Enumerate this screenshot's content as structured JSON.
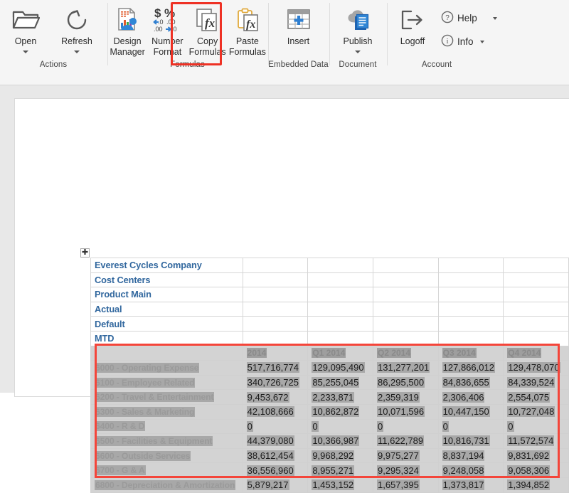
{
  "ribbon": {
    "groups": [
      {
        "name": "actions",
        "label": "Actions",
        "buttons": [
          {
            "name": "open-button",
            "label": "Open",
            "icon": "folder-open-icon",
            "dropdown": true
          },
          {
            "name": "refresh-button",
            "label": "Refresh",
            "icon": "refresh-icon",
            "dropdown": true
          }
        ]
      },
      {
        "name": "formulas",
        "label": "Formulas",
        "buttons": [
          {
            "name": "design-manager-button",
            "label": "Design\nManager",
            "icon": "design-manager-icon",
            "dropdown": false
          },
          {
            "name": "number-format-button",
            "label": "Number\nFormat",
            "icon": "number-format-icon",
            "dropdown": false
          },
          {
            "name": "copy-formulas-button",
            "label": "Copy\nFormulas",
            "icon": "copy-formulas-icon",
            "dropdown": false,
            "highlighted": true
          },
          {
            "name": "paste-formulas-button",
            "label": "Paste\nFormulas",
            "icon": "paste-formulas-icon",
            "dropdown": false
          }
        ]
      },
      {
        "name": "embedded-data",
        "label": "Embedded Data",
        "buttons": [
          {
            "name": "insert-button",
            "label": "Insert",
            "icon": "insert-table-icon",
            "dropdown": false
          }
        ]
      },
      {
        "name": "document",
        "label": "Document",
        "buttons": [
          {
            "name": "publish-button",
            "label": "Publish",
            "icon": "publish-cloud-icon",
            "dropdown": true
          }
        ]
      },
      {
        "name": "account",
        "label": "Account",
        "buttons": [
          {
            "name": "logoff-button",
            "label": "Logoff",
            "icon": "logoff-icon",
            "dropdown": false
          }
        ],
        "small_buttons": [
          {
            "name": "help-button",
            "label": "Help",
            "icon": "help-circle-icon",
            "dropdown": true
          },
          {
            "name": "info-button",
            "label": "Info",
            "icon": "info-circle-icon",
            "dropdown": true
          }
        ]
      }
    ],
    "number_format_icon_text": {
      "currency": "$",
      "percent": "%",
      "decrease_decimal": ".00",
      "increase_decimal": ".0"
    }
  },
  "document": {
    "move_handle_icon": "move-table-handle-icon",
    "report_header_rows": [
      "Everest Cycles Company",
      "Cost Centers",
      "Product Main",
      "Actual",
      "Default",
      "MTD"
    ]
  },
  "grid": {
    "selected": true,
    "selection_color": "#f4453a",
    "header_text_color": "#31679e",
    "column_headers": [
      "",
      "2014",
      "Q1 2014",
      "Q2 2014",
      "Q3 2014",
      "Q4 2014"
    ],
    "rows": [
      {
        "label": "6000 - Operating Expense",
        "values": [
          "517,716,774",
          "129,095,490",
          "131,277,201",
          "127,866,012",
          "129,478,070"
        ]
      },
      {
        "label": "6100 - Employee Related",
        "values": [
          "340,726,725",
          "85,255,045",
          "86,295,500",
          "84,836,655",
          "84,339,524"
        ]
      },
      {
        "label": "6200 - Travel & Entertainment",
        "values": [
          "9,453,672",
          "2,233,871",
          "2,359,319",
          "2,306,406",
          "2,554,075"
        ]
      },
      {
        "label": "6300 - Sales & Marketing",
        "values": [
          "42,108,666",
          "10,862,872",
          "10,071,596",
          "10,447,150",
          "10,727,048"
        ]
      },
      {
        "label": "6400 - R & D",
        "values": [
          "0",
          "0",
          "0",
          "0",
          "0"
        ]
      },
      {
        "label": "6500 - Facilities & Equipment",
        "values": [
          "44,379,080",
          "10,366,987",
          "11,622,789",
          "10,816,731",
          "11,572,574"
        ]
      },
      {
        "label": "6600 - Outside Services",
        "values": [
          "38,612,454",
          "9,968,292",
          "9,975,277",
          "8,837,194",
          "9,831,692"
        ]
      },
      {
        "label": "6700 - G & A",
        "values": [
          "36,556,960",
          "8,955,271",
          "9,295,324",
          "9,248,058",
          "9,058,306"
        ]
      },
      {
        "label": "6800 - Depreciation & Amortization",
        "values": [
          "5,879,217",
          "1,453,152",
          "1,657,395",
          "1,373,817",
          "1,394,852"
        ]
      }
    ]
  }
}
